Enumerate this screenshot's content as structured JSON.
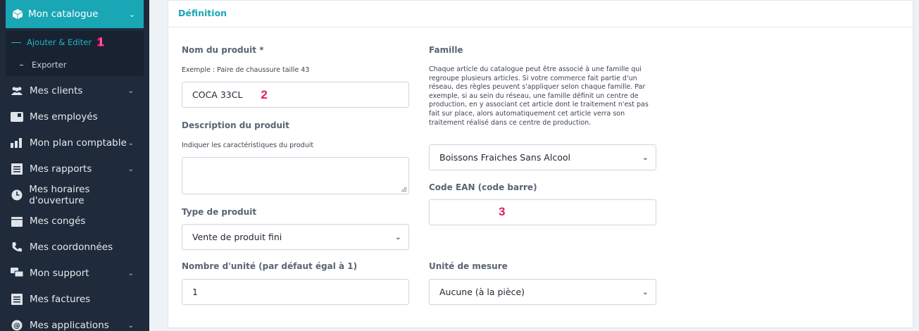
{
  "sidebar": {
    "active": {
      "label": "Mon catalogue",
      "icon": "box-icon"
    },
    "sub_items": [
      {
        "label": "Ajouter & Editer",
        "badge": "1"
      },
      {
        "label": "Exporter"
      }
    ],
    "items": [
      {
        "label": "Mes clients",
        "icon": "users-icon",
        "has_chevron": true
      },
      {
        "label": "Mes employés",
        "icon": "id-card-icon",
        "has_chevron": false
      },
      {
        "label": "Mon plan comptable",
        "icon": "bar-chart-icon",
        "has_chevron": true
      },
      {
        "label": "Mes rapports",
        "icon": "list-icon",
        "has_chevron": true
      },
      {
        "label": "Mes horaires d'ouverture",
        "icon": "clock-icon",
        "has_chevron": false
      },
      {
        "label": "Mes congés",
        "icon": "calendar-icon",
        "has_chevron": false
      },
      {
        "label": "Mes coordonnées",
        "icon": "phone-icon",
        "has_chevron": false
      },
      {
        "label": "Mon support",
        "icon": "chat-icon",
        "has_chevron": true
      },
      {
        "label": "Mes factures",
        "icon": "invoice-icon",
        "has_chevron": false
      },
      {
        "label": "Mes applications",
        "icon": "at-icon",
        "has_chevron": true
      }
    ]
  },
  "card": {
    "title": "Définition"
  },
  "form": {
    "product_name": {
      "label": "Nom du produit *",
      "hint": "Exemple : Paire de chaussure taille 43",
      "value": "COCA 33CL",
      "badge": "2"
    },
    "description": {
      "label": "Description du produit",
      "hint": "Indiquer les caractéristiques du produit",
      "value": ""
    },
    "product_type": {
      "label": "Type de produit",
      "value": "Vente de produit fini"
    },
    "unit_count": {
      "label": "Nombre d'unité (par défaut égal à 1)",
      "value": "1"
    },
    "family": {
      "label": "Famille",
      "hint_lines": [
        "Chaque article du catalogue peut être associé à une famille qui",
        "regroupe plusieurs articles. Si votre commerce fait partie d'un",
        "réseau, des règles peuvent s'appliquer selon chaque famille. Par",
        "exemple, si au sein du réseau, une famille définit un centre de",
        "production, en y associant cet article dont le traitement n'est pas",
        "fait sur place, alors automatiquement cet article verra son",
        "traitement réalisé dans ce centre de production."
      ],
      "value": "Boissons Fraiches Sans Alcool"
    },
    "ean": {
      "label": "Code EAN (code barre)",
      "value": "",
      "badge": "3"
    },
    "unit_measure": {
      "label": "Unité de mesure",
      "value": "Aucune (à la pièce)"
    }
  },
  "colors": {
    "accent": "#19a7b6",
    "sidebar_bg": "#1f2a3a",
    "annotation": "#e6196b"
  }
}
